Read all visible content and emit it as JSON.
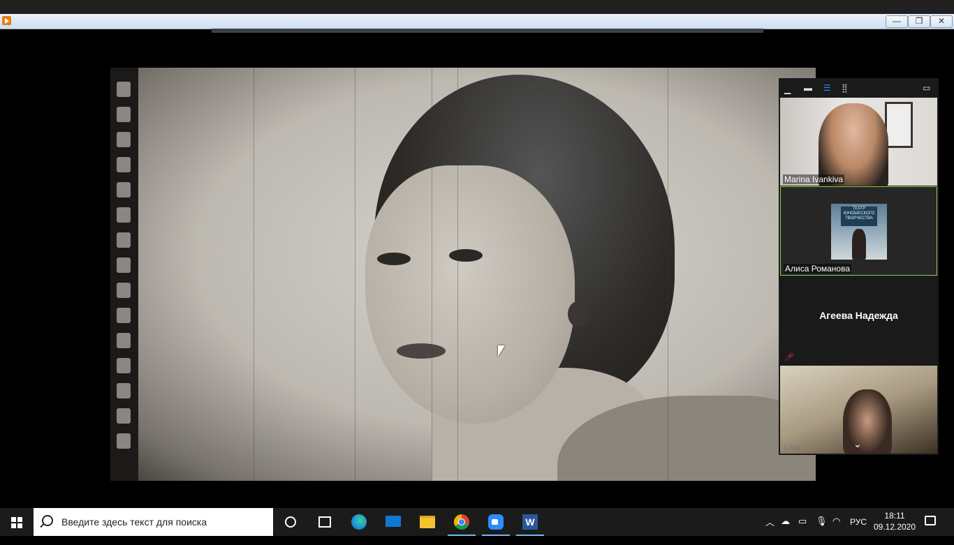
{
  "window": {
    "controls": {
      "minimize": "—",
      "restore": "❐",
      "close": "✕"
    }
  },
  "gallery": {
    "participants": [
      {
        "name": "Marina Ivankiva",
        "video": true,
        "active": false
      },
      {
        "name": "Алиса Романова",
        "video": true,
        "active": true,
        "sign_text": "ТЕАТР ЮНОШЕСКОГО ТВОРЧЕСТВА"
      },
      {
        "name": "Агеева Надежда",
        "video": false,
        "muted": true
      },
      {
        "name": "Lisa",
        "video": true
      }
    ],
    "toolbar_icons": [
      "minimize-panel-icon",
      "single-tile-icon",
      "strip-view-icon",
      "grid-view-icon",
      "exit-fullscreen-icon"
    ]
  },
  "taskbar": {
    "search_placeholder": "Введите здесь текст для поиска",
    "apps": [
      "cortana-icon",
      "task-view-icon",
      "edge-icon",
      "mail-icon",
      "file-explorer-icon",
      "chrome-icon",
      "zoom-icon",
      "word-icon"
    ],
    "language": "РУС",
    "time": "18:11",
    "date": "09.12.2020",
    "colors": {
      "active_indicator": "#76b9ed",
      "zoom_blue": "#2d8cff",
      "word_blue": "#2b579a"
    }
  }
}
